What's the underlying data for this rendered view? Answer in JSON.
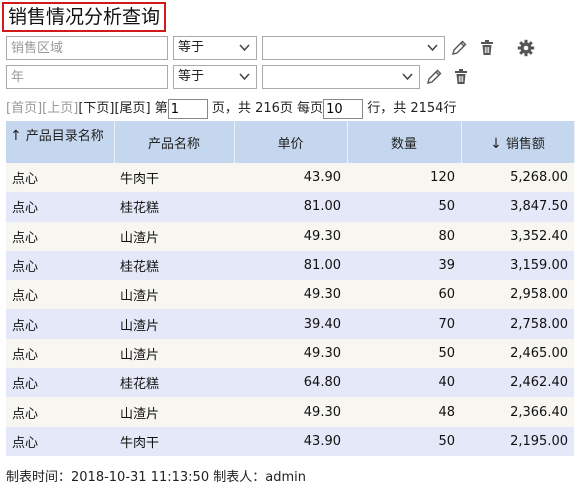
{
  "title": "销售情况分析查询",
  "filters": [
    {
      "field_placeholder": "销售区域",
      "operator": "等于",
      "value": ""
    },
    {
      "field_placeholder": "年",
      "operator": "等于",
      "value": ""
    }
  ],
  "pager": {
    "first": "[首页]",
    "prev": "[上页]",
    "next": "[下页]",
    "last": "[尾页]",
    "page_prefix": "第",
    "current_page": "1",
    "page_suffix": "页，共",
    "total_pages": "216页",
    "per_page_prefix": "每页",
    "per_page": "10",
    "per_page_suffix": "行，共",
    "total_rows": "2154行"
  },
  "table": {
    "columns": [
      {
        "label": "产品目录名称",
        "sort": "↑"
      },
      {
        "label": "产品名称",
        "sort": ""
      },
      {
        "label": "单价",
        "sort": ""
      },
      {
        "label": "数量",
        "sort": ""
      },
      {
        "label": "销售额",
        "sort": "↓"
      }
    ],
    "rows": [
      [
        "点心",
        "牛肉干",
        "43.90",
        "120",
        "5,268.00"
      ],
      [
        "点心",
        "桂花糕",
        "81.00",
        "50",
        "3,847.50"
      ],
      [
        "点心",
        "山渣片",
        "49.30",
        "80",
        "3,352.40"
      ],
      [
        "点心",
        "桂花糕",
        "81.00",
        "39",
        "3,159.00"
      ],
      [
        "点心",
        "山渣片",
        "49.30",
        "60",
        "2,958.00"
      ],
      [
        "点心",
        "山渣片",
        "39.40",
        "70",
        "2,758.00"
      ],
      [
        "点心",
        "山渣片",
        "49.30",
        "50",
        "2,465.00"
      ],
      [
        "点心",
        "桂花糕",
        "64.80",
        "40",
        "2,462.40"
      ],
      [
        "点心",
        "山渣片",
        "49.30",
        "48",
        "2,366.40"
      ],
      [
        "点心",
        "牛肉干",
        "43.90",
        "50",
        "2,195.00"
      ]
    ]
  },
  "footer": {
    "made_time_label": "制表时间：",
    "made_time": "2018-10-31 11:13:50",
    "maker_label": "制表人：",
    "maker": "admin"
  },
  "icons": {
    "edit": "pencil-icon",
    "delete": "trash-icon",
    "settings": "gear-icon"
  },
  "colors": {
    "title_border": "#d11a1a",
    "header_bg": "#c5d7ee",
    "row_odd": "#f7f6f0",
    "row_even": "#e4e8f8"
  }
}
